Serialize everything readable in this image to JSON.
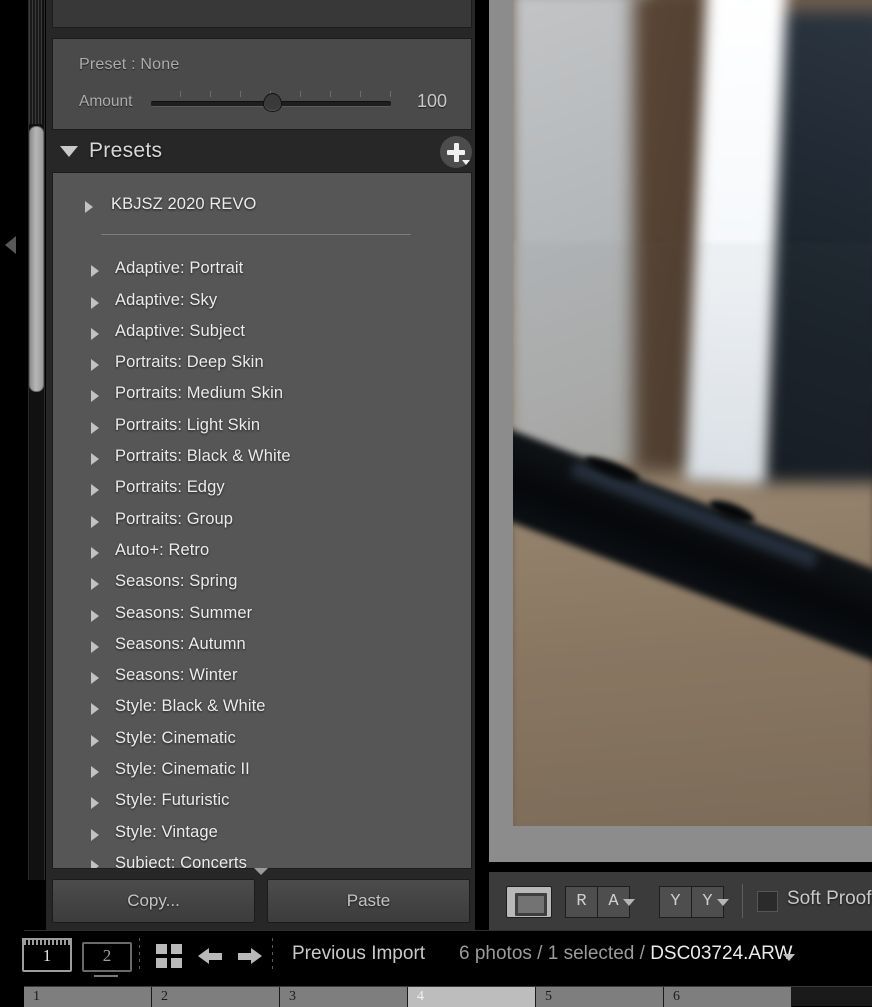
{
  "left_panel": {
    "preset_row": {
      "label": "Preset : None"
    },
    "amount": {
      "label": "Amount",
      "value": "100"
    },
    "presets_section": {
      "title": "Presets",
      "disclosure_icon": "triangle-down-icon",
      "add_icon": "plus-circle-icon",
      "items": [
        {
          "label": "KBJSZ 2020 REVO",
          "icon": "triangle-right-icon"
        },
        {
          "label": "Adaptive: Portrait",
          "icon": "triangle-right-icon"
        },
        {
          "label": "Adaptive: Sky",
          "icon": "triangle-right-icon"
        },
        {
          "label": "Adaptive: Subject",
          "icon": "triangle-right-icon"
        },
        {
          "label": "Portraits: Deep Skin",
          "icon": "triangle-right-icon"
        },
        {
          "label": "Portraits: Medium Skin",
          "icon": "triangle-right-icon"
        },
        {
          "label": "Portraits: Light Skin",
          "icon": "triangle-right-icon"
        },
        {
          "label": "Portraits: Black & White",
          "icon": "triangle-right-icon"
        },
        {
          "label": "Portraits: Edgy",
          "icon": "triangle-right-icon"
        },
        {
          "label": "Portraits: Group",
          "icon": "triangle-right-icon"
        },
        {
          "label": "Auto+: Retro",
          "icon": "triangle-right-icon"
        },
        {
          "label": "Seasons: Spring",
          "icon": "triangle-right-icon"
        },
        {
          "label": "Seasons: Summer",
          "icon": "triangle-right-icon"
        },
        {
          "label": "Seasons: Autumn",
          "icon": "triangle-right-icon"
        },
        {
          "label": "Seasons: Winter",
          "icon": "triangle-right-icon"
        },
        {
          "label": "Style: Black & White",
          "icon": "triangle-right-icon"
        },
        {
          "label": "Style: Cinematic",
          "icon": "triangle-right-icon"
        },
        {
          "label": "Style: Cinematic II",
          "icon": "triangle-right-icon"
        },
        {
          "label": "Style: Futuristic",
          "icon": "triangle-right-icon"
        },
        {
          "label": "Style: Vintage",
          "icon": "triangle-right-icon"
        },
        {
          "label": "Subject: Concerts",
          "icon": "triangle-right-icon"
        }
      ]
    },
    "copy_button": "Copy...",
    "paste_button": "Paste"
  },
  "image_toolbar": {
    "loupe_icon": "loupe-view-icon",
    "compare_r": "R",
    "compare_a": "A",
    "before_y1": "Y",
    "before_y2": "Y",
    "soft_proofing_label": "Soft Proofing"
  },
  "bottom_bar": {
    "monitor_1": "1",
    "monitor_2": "2",
    "grid_icon": "grid-view-icon",
    "back_icon": "arrow-left-icon",
    "forward_icon": "arrow-right-icon",
    "source": "Previous Import",
    "photo_count": "6 photos /",
    "selected_count": "1 selected /",
    "filename": "DSC03724.ARW",
    "filename_chevron_icon": "chevron-down-icon"
  },
  "filmstrip": {
    "thumbnails": [
      "1",
      "2",
      "3",
      "4",
      "5",
      "6"
    ],
    "selected_index": 3
  },
  "colors": {
    "panel_bg": "#272727",
    "list_bg": "#565656",
    "box_bg": "#4a4a4a",
    "mat_bg": "#8c8c8c",
    "toolbar_bg": "#3b3b3b"
  }
}
